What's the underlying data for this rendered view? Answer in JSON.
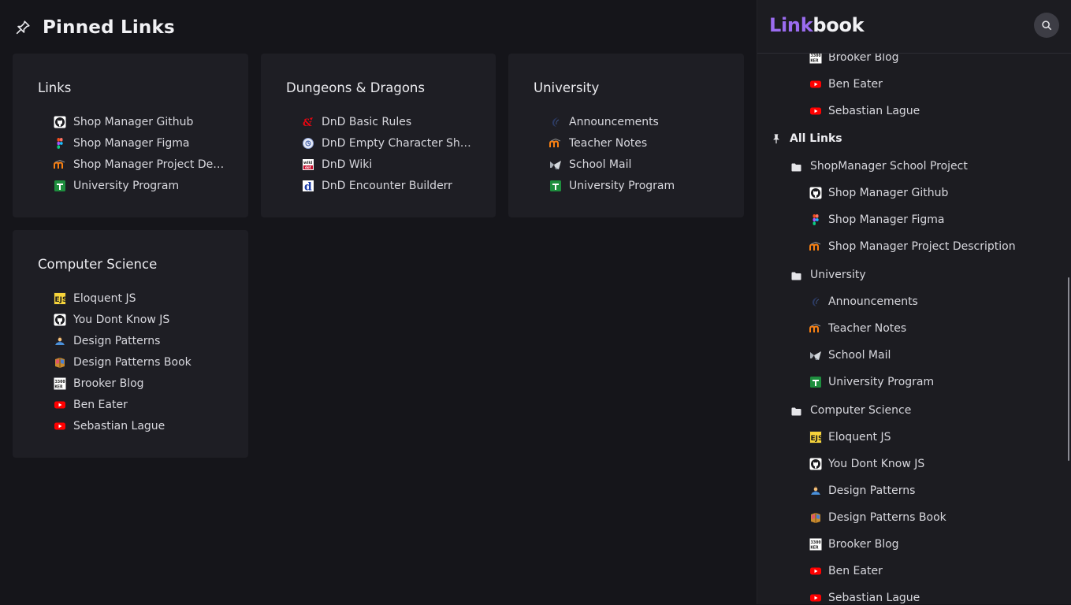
{
  "main": {
    "title": "Pinned Links",
    "cards": [
      {
        "title": "Links",
        "links": [
          {
            "label": "Shop Manager Github",
            "icon": "github-icon"
          },
          {
            "label": "Shop Manager Figma",
            "icon": "figma-icon"
          },
          {
            "label": "Shop Manager Project De…",
            "icon": "moodle-icon"
          },
          {
            "label": "University Program",
            "icon": "sheets-icon"
          }
        ]
      },
      {
        "title": "Dungeons & Dragons",
        "links": [
          {
            "label": "DnD Basic Rules",
            "icon": "dnd-icon"
          },
          {
            "label": "DnD Empty Character Sh…",
            "icon": "globe-icon"
          },
          {
            "label": "DnD Wiki",
            "icon": "wikidot-icon"
          },
          {
            "label": "DnD Encounter Builderr",
            "icon": "d-icon"
          }
        ]
      },
      {
        "title": "University",
        "links": [
          {
            "label": "Announcements",
            "icon": "moon-icon"
          },
          {
            "label": "Teacher Notes",
            "icon": "moodle-icon"
          },
          {
            "label": "School Mail",
            "icon": "mail-icon"
          },
          {
            "label": "University Program",
            "icon": "sheets-icon"
          }
        ]
      },
      {
        "title": "Computer Science",
        "links": [
          {
            "label": "Eloquent JS",
            "icon": "ejs-icon"
          },
          {
            "label": "You Dont Know JS",
            "icon": "github-icon"
          },
          {
            "label": "Design Patterns",
            "icon": "refactoring-icon"
          },
          {
            "label": "Design Patterns Book",
            "icon": "book-icon"
          },
          {
            "label": "Brooker Blog",
            "icon": "brooker-icon"
          },
          {
            "label": "Ben Eater",
            "icon": "youtube-icon"
          },
          {
            "label": "Sebastian Lague",
            "icon": "youtube-icon"
          }
        ]
      }
    ]
  },
  "sidebar": {
    "brand_part1": "Link",
    "brand_part2": "book",
    "top_links": [
      {
        "label": "Brooker Blog",
        "icon": "brooker-icon"
      },
      {
        "label": "Ben Eater",
        "icon": "youtube-icon"
      },
      {
        "label": "Sebastian Lague",
        "icon": "youtube-icon"
      }
    ],
    "all_links_label": "All Links",
    "folders": [
      {
        "name": "ShopManager School Project",
        "links": [
          {
            "label": "Shop Manager Github",
            "icon": "github-icon"
          },
          {
            "label": "Shop Manager Figma",
            "icon": "figma-icon"
          },
          {
            "label": "Shop Manager Project Description",
            "icon": "moodle-icon"
          }
        ]
      },
      {
        "name": "University",
        "links": [
          {
            "label": "Announcements",
            "icon": "moon-icon"
          },
          {
            "label": "Teacher Notes",
            "icon": "moodle-icon"
          },
          {
            "label": "School Mail",
            "icon": "mail-icon"
          },
          {
            "label": "University Program",
            "icon": "sheets-icon"
          }
        ]
      },
      {
        "name": "Computer Science",
        "links": [
          {
            "label": "Eloquent JS",
            "icon": "ejs-icon"
          },
          {
            "label": "You Dont Know JS",
            "icon": "github-icon"
          },
          {
            "label": "Design Patterns",
            "icon": "refactoring-icon"
          },
          {
            "label": "Design Patterns Book",
            "icon": "book-icon"
          },
          {
            "label": "Brooker Blog",
            "icon": "brooker-icon"
          },
          {
            "label": "Ben Eater",
            "icon": "youtube-icon"
          },
          {
            "label": "Sebastian Lague",
            "icon": "youtube-icon"
          }
        ]
      }
    ]
  },
  "colors": {
    "background": "#15151a",
    "card": "#1e1e24",
    "sidebar": "#1c1c21",
    "brand_accent": "#9b6cf0"
  }
}
